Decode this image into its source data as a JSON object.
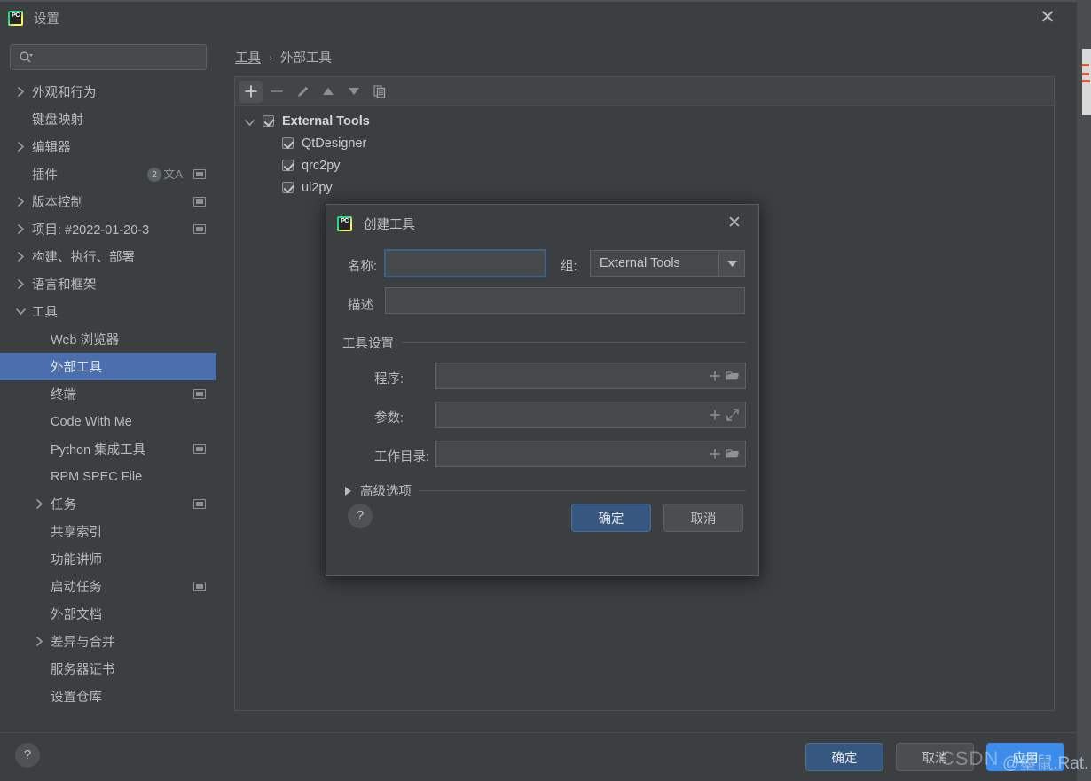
{
  "window": {
    "title": "设置",
    "app_icon": "pycharm-icon",
    "close_label": "✕"
  },
  "search": {
    "placeholder": "",
    "value": "",
    "icon": "search-icon"
  },
  "sidebar": {
    "items": [
      {
        "label": "外观和行为",
        "depth": 0,
        "arrow": "collapsed",
        "badge": null,
        "translate": false,
        "chip": false
      },
      {
        "label": "键盘映射",
        "depth": 0,
        "arrow": null,
        "badge": null,
        "translate": false,
        "chip": false
      },
      {
        "label": "编辑器",
        "depth": 0,
        "arrow": "collapsed",
        "badge": null,
        "translate": false,
        "chip": false
      },
      {
        "label": "插件",
        "depth": 0,
        "arrow": null,
        "badge": "2",
        "translate": true,
        "chip": true
      },
      {
        "label": "版本控制",
        "depth": 0,
        "arrow": "collapsed",
        "badge": null,
        "translate": false,
        "chip": true
      },
      {
        "label": "项目: #2022-01-20-3",
        "depth": 0,
        "arrow": "collapsed",
        "badge": null,
        "translate": false,
        "chip": true
      },
      {
        "label": "构建、执行、部署",
        "depth": 0,
        "arrow": "collapsed",
        "badge": null,
        "translate": false,
        "chip": false
      },
      {
        "label": "语言和框架",
        "depth": 0,
        "arrow": "collapsed",
        "badge": null,
        "translate": false,
        "chip": false
      },
      {
        "label": "工具",
        "depth": 0,
        "arrow": "expanded",
        "badge": null,
        "translate": false,
        "chip": false
      },
      {
        "label": "Web 浏览器",
        "depth": 1,
        "arrow": null,
        "badge": null,
        "translate": false,
        "chip": false
      },
      {
        "label": "外部工具",
        "depth": 1,
        "arrow": null,
        "badge": null,
        "translate": false,
        "chip": false,
        "selected": true
      },
      {
        "label": "终端",
        "depth": 1,
        "arrow": null,
        "badge": null,
        "translate": false,
        "chip": true
      },
      {
        "label": "Code With Me",
        "depth": 1,
        "arrow": null,
        "badge": null,
        "translate": false,
        "chip": false
      },
      {
        "label": "Python 集成工具",
        "depth": 1,
        "arrow": null,
        "badge": null,
        "translate": false,
        "chip": true
      },
      {
        "label": "RPM SPEC File",
        "depth": 1,
        "arrow": null,
        "badge": null,
        "translate": false,
        "chip": false
      },
      {
        "label": "任务",
        "depth": 1,
        "arrow": "collapsed",
        "badge": null,
        "translate": false,
        "chip": true
      },
      {
        "label": "共享索引",
        "depth": 1,
        "arrow": null,
        "badge": null,
        "translate": false,
        "chip": false
      },
      {
        "label": "功能讲师",
        "depth": 1,
        "arrow": null,
        "badge": null,
        "translate": false,
        "chip": false
      },
      {
        "label": "启动任务",
        "depth": 1,
        "arrow": null,
        "badge": null,
        "translate": false,
        "chip": true
      },
      {
        "label": "外部文档",
        "depth": 1,
        "arrow": null,
        "badge": null,
        "translate": false,
        "chip": false
      },
      {
        "label": "差异与合并",
        "depth": 1,
        "arrow": "collapsed",
        "badge": null,
        "translate": false,
        "chip": false
      },
      {
        "label": "服务器证书",
        "depth": 1,
        "arrow": null,
        "badge": null,
        "translate": false,
        "chip": false
      },
      {
        "label": "设置仓库",
        "depth": 1,
        "arrow": null,
        "badge": null,
        "translate": false,
        "chip": false
      }
    ]
  },
  "breadcrumb": {
    "parent": "工具",
    "separator": "›",
    "current": "外部工具"
  },
  "panel": {
    "toolbar": [
      {
        "name": "add-button",
        "glyph": "plus",
        "active": true
      },
      {
        "name": "remove-button",
        "glyph": "minus",
        "active": false
      },
      {
        "name": "edit-button",
        "glyph": "pencil",
        "active": false
      },
      {
        "name": "move-up-button",
        "glyph": "arrow-up",
        "active": false
      },
      {
        "name": "move-down-button",
        "glyph": "arrow-down",
        "active": false
      },
      {
        "name": "copy-button",
        "glyph": "copy",
        "active": false
      }
    ],
    "tree": {
      "root": {
        "label": "External Tools",
        "checked": true,
        "expanded": true
      },
      "children": [
        {
          "label": "QtDesigner",
          "checked": true
        },
        {
          "label": "qrc2py",
          "checked": true
        },
        {
          "label": "ui2py",
          "checked": true
        }
      ]
    }
  },
  "dialog": {
    "title": "创建工具",
    "close_label": "✕",
    "name_label": "名称:",
    "name_value": "",
    "group_label": "组:",
    "group_value": "External Tools",
    "desc_label": "描述",
    "desc_value": "",
    "section_title": "工具设置",
    "fields": [
      {
        "label": "程序:",
        "value": "",
        "icon1": "plus-icon",
        "icon2": "folder-icon"
      },
      {
        "label": "参数:",
        "value": "",
        "icon1": "plus-icon",
        "icon2": "expand-icon"
      },
      {
        "label": "工作目录:",
        "value": "",
        "icon1": "plus-icon",
        "icon2": "folder-icon"
      }
    ],
    "advanced_label": "高级选项",
    "help_label": "?",
    "ok_label": "确定",
    "cancel_label": "取消"
  },
  "bottom": {
    "help_label": "?",
    "ok_label": "确定",
    "cancel_label": "取消",
    "apply_label": "应用"
  },
  "watermark": {
    "text": "CSDN",
    "handle": "@墨鼠.Rat."
  },
  "colors": {
    "background": "#3C3F41",
    "selection": "#4B6EAF",
    "primary_button": "#365880",
    "focus_border": "#3D6185",
    "blue_button": "#3C8CEB",
    "text": "#BBBBBB"
  }
}
